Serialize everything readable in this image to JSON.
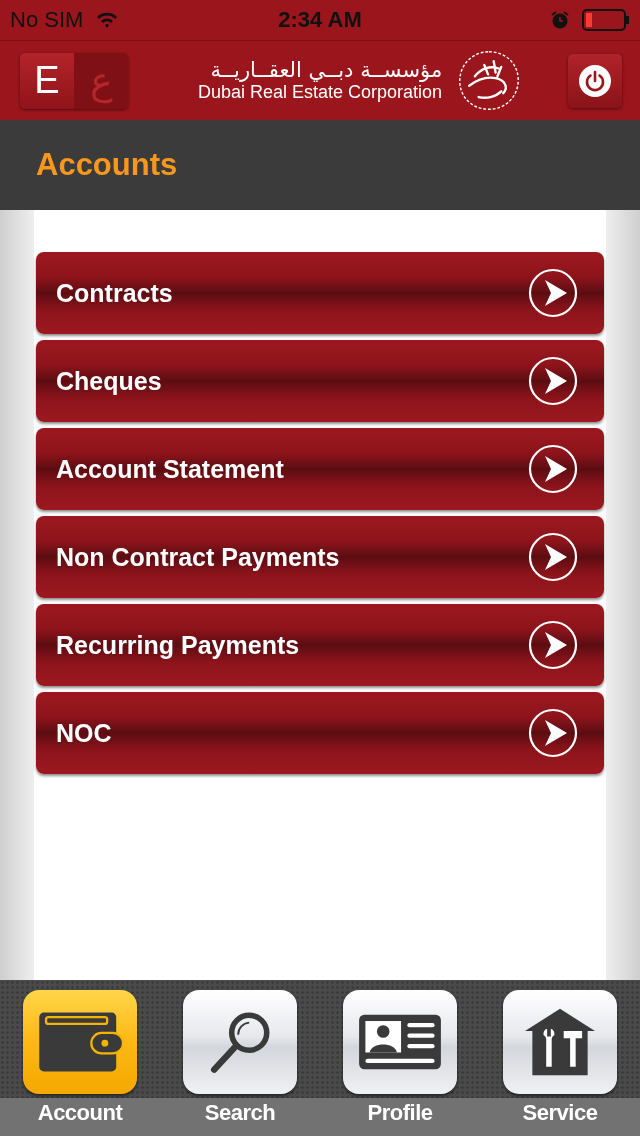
{
  "status_bar": {
    "carrier": "No SIM",
    "time": "2:34 AM"
  },
  "header": {
    "languages": [
      {
        "label": "E",
        "selected": true
      },
      {
        "label": "ع",
        "selected": false
      }
    ],
    "org_name_arabic": "مؤسســة دبــي العقــاريــة",
    "org_name": "Dubai Real Estate Corporation"
  },
  "page_title": "Accounts",
  "menu_items": [
    {
      "label": "Contracts"
    },
    {
      "label": "Cheques"
    },
    {
      "label": "Account Statement"
    },
    {
      "label": "Non Contract Payments"
    },
    {
      "label": "Recurring Payments"
    },
    {
      "label": "NOC"
    }
  ],
  "tabs": [
    {
      "label": "Account",
      "kind": "wallet",
      "selected": true
    },
    {
      "label": "Search",
      "kind": "search",
      "selected": false
    },
    {
      "label": "Profile",
      "kind": "card",
      "selected": false
    },
    {
      "label": "Service",
      "kind": "tools",
      "selected": false
    }
  ]
}
